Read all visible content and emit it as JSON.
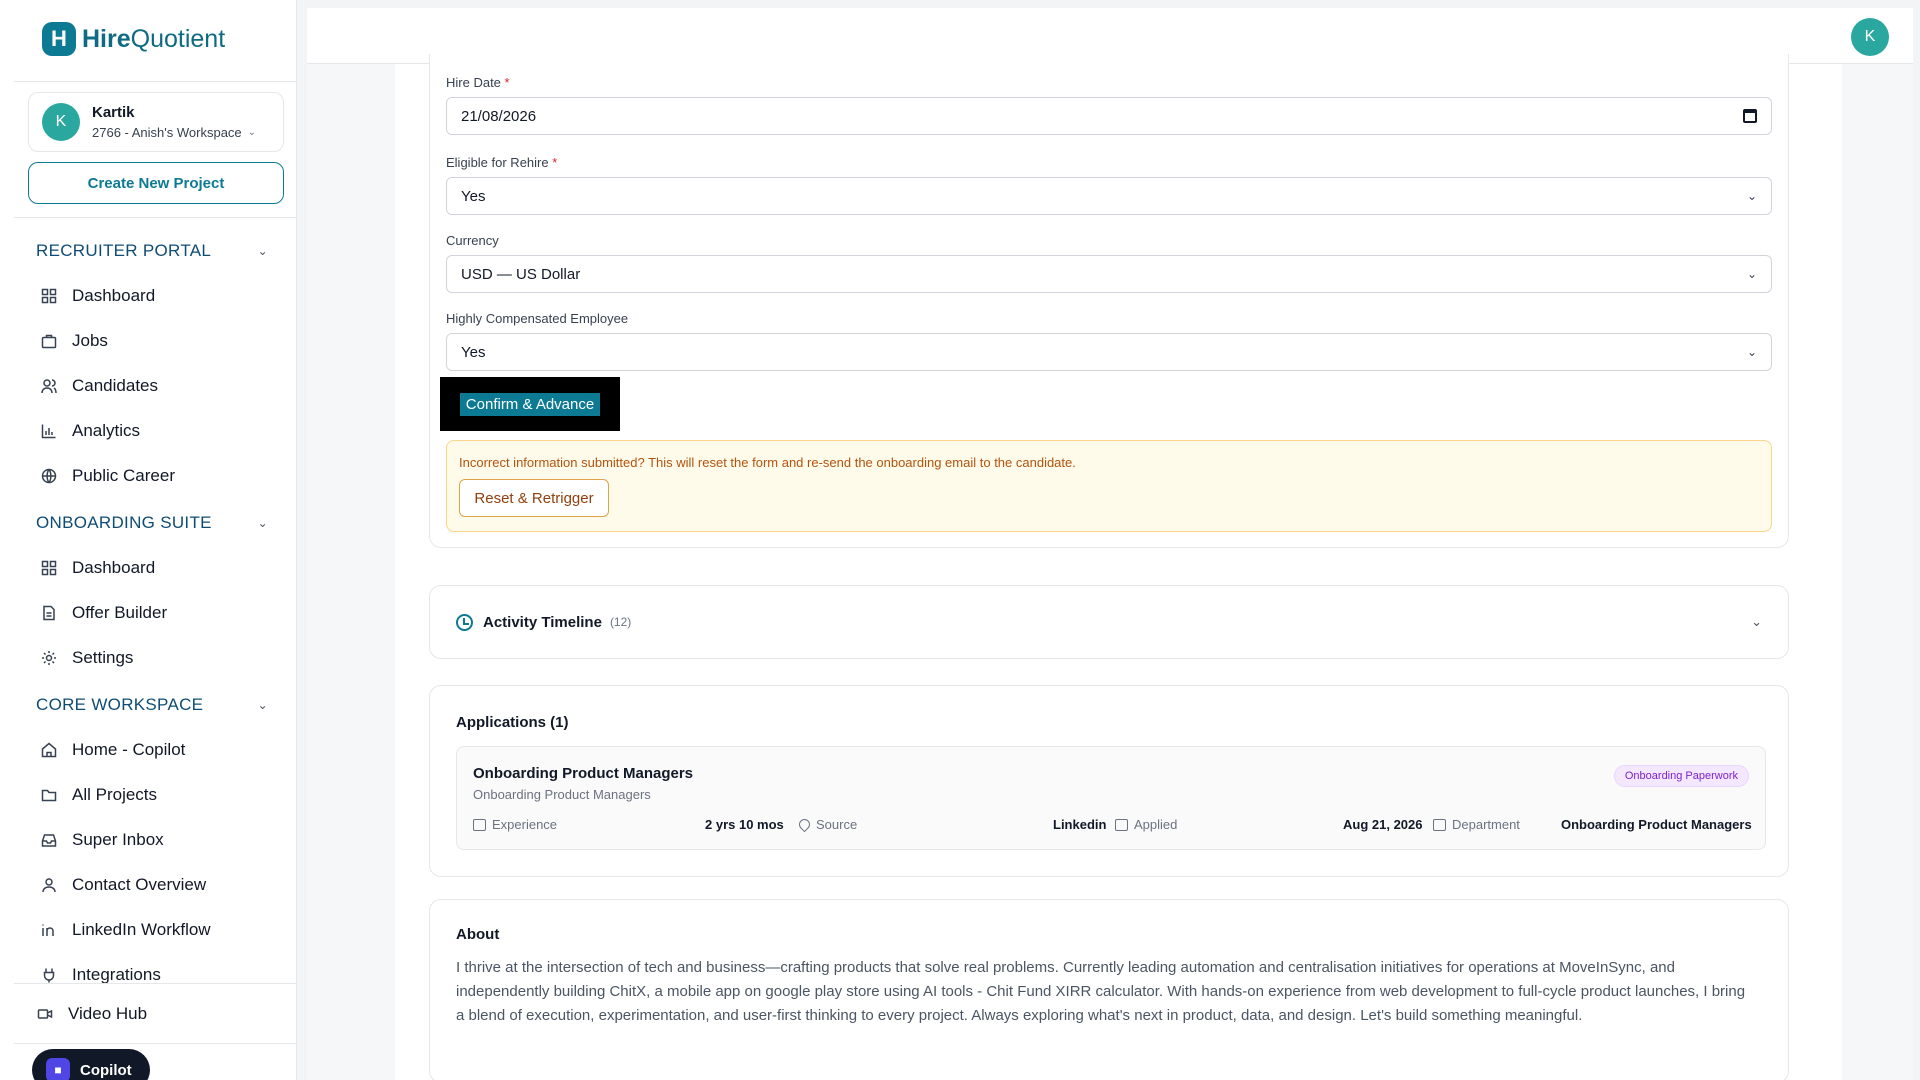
{
  "brand": {
    "name_bold": "Hire",
    "name_rest": "Quotient",
    "logo_letter": "H"
  },
  "user": {
    "initial": "K",
    "name": "Kartik",
    "workspace": "2766 - Anish's Workspace"
  },
  "sidebar": {
    "create_label": "Create New Project",
    "sections": [
      {
        "title": "RECRUITER PORTAL",
        "items": [
          {
            "label": "Dashboard",
            "icon": "grid-icon"
          },
          {
            "label": "Jobs",
            "icon": "briefcase-icon"
          },
          {
            "label": "Candidates",
            "icon": "users-icon"
          },
          {
            "label": "Analytics",
            "icon": "bar-chart-icon"
          },
          {
            "label": "Public Career",
            "icon": "globe-icon"
          }
        ]
      },
      {
        "title": "ONBOARDING SUITE",
        "items": [
          {
            "label": "Dashboard",
            "icon": "grid-icon"
          },
          {
            "label": "Offer Builder",
            "icon": "document-icon"
          },
          {
            "label": "Settings",
            "icon": "gear-icon"
          }
        ]
      },
      {
        "title": "CORE WORKSPACE",
        "items": [
          {
            "label": "Home - Copilot",
            "icon": "home-icon"
          },
          {
            "label": "All Projects",
            "icon": "folder-icon"
          },
          {
            "label": "Super Inbox",
            "icon": "inbox-icon"
          },
          {
            "label": "Contact Overview",
            "icon": "contact-icon"
          },
          {
            "label": "LinkedIn Workflow",
            "icon": "linkedin-icon"
          },
          {
            "label": "Integrations",
            "icon": "plug-icon"
          }
        ]
      }
    ],
    "video_hub": "Video Hub",
    "copilot": "Copilot"
  },
  "form": {
    "hire_date": {
      "label": "Hire Date",
      "required": "*",
      "value": "21/08/2026"
    },
    "rehire": {
      "label": "Eligible for Rehire",
      "required": "*",
      "value": "Yes"
    },
    "currency": {
      "label": "Currency",
      "value": "USD — US Dollar"
    },
    "highly_comp": {
      "label": "Highly Compensated Employee",
      "value": "Yes"
    },
    "confirm_label": "Confirm & Advance",
    "warning_text": "Incorrect information submitted? This will reset the form and re-send the onboarding email to the candidate.",
    "reset_label": "Reset & Retrigger"
  },
  "timeline": {
    "title": "Activity Timeline",
    "count": "(12)"
  },
  "applications": {
    "heading": "Applications (1)",
    "items": [
      {
        "title": "Onboarding Product Managers",
        "subtitle": "Onboarding Product Managers",
        "badge": "Onboarding Paperwork",
        "experience_label": "Experience",
        "experience_value": "2 yrs 10 mos",
        "source_label": "Source",
        "source_value": "Linkedin",
        "applied_label": "Applied",
        "applied_value": "Aug 21, 2026",
        "department_label": "Department",
        "department_value": "Onboarding Product Managers"
      }
    ]
  },
  "about": {
    "heading": "About",
    "text": "I thrive at the intersection of tech and business—crafting products that solve real problems. Currently leading automation and centralisation initiatives for operations at MoveInSync, and independently building ChitX, a mobile app on google play store using AI tools - Chit Fund XIRR calculator. With hands-on experience from web development to full-cycle product launches, I bring a blend of execution, experimentation, and user-first thinking to every project. Always exploring what's next in product, data, and design. Let's build something meaningful."
  },
  "colors": {
    "accent": "#0d7a93",
    "avatar": "#2aa8a0",
    "warning_bg": "#fefbea",
    "badge": "#7e22ce"
  }
}
